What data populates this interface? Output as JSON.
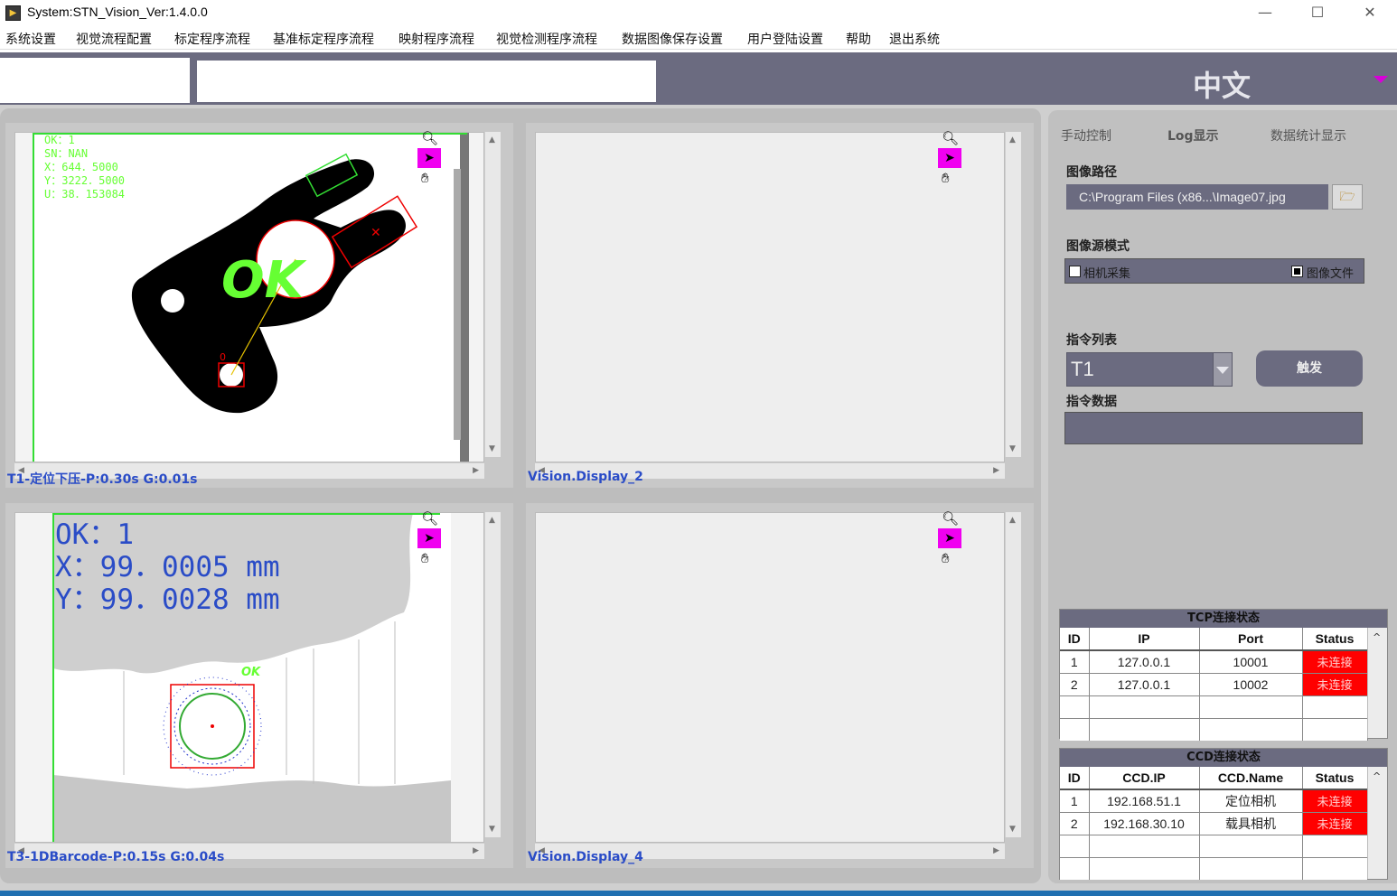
{
  "window": {
    "title": "System:STN_Vision_Ver:1.4.0.0",
    "icon": "app-icon",
    "controls": [
      "minimize-icon",
      "maximize-icon",
      "close-icon"
    ]
  },
  "menu": [
    "系统设置",
    "视觉流程配置",
    "标定程序流程",
    "基准标定程序流程",
    "映射程序流程",
    "视觉检测程序流程",
    "数据图像保存设置",
    "用户登陆设置",
    "帮助",
    "退出系统"
  ],
  "toolbar": {
    "language": "中文"
  },
  "displays": [
    {
      "caption": "T1-定位下压-P:0.30s G:0.01s",
      "overlay": [
        "OK：1",
        "SN：NAN",
        "X：644．5000",
        "Y：3222．5000",
        "U：38．153084"
      ],
      "result": "OK",
      "point_label": "0"
    },
    {
      "caption": "Vision.Display_2"
    },
    {
      "caption": "T3-1DBarcode-P:0.15s G:0.04s",
      "overlay": [
        "OK：1",
        "X：99．0005 mm",
        "Y：99．0028 mm"
      ],
      "result": "OK"
    },
    {
      "caption": "Vision.Display_4"
    }
  ],
  "right_panel": {
    "tabs": [
      "手动控制",
      "Log显示",
      "数据统计显示"
    ],
    "image_path_label": "图像路径",
    "image_path": "C:\\Program Files (x86...\\Image07.jpg",
    "source_mode_label": "图像源模式",
    "source_camera": "相机采集",
    "source_file": "图像文件",
    "source_selected": "图像文件",
    "command_list_label": "指令列表",
    "command_value": "T1",
    "trigger_label": "触发",
    "command_data_label": "指令数据",
    "command_data": ""
  },
  "tcp_table": {
    "title": "TCP连接状态",
    "headers": [
      "ID",
      "IP",
      "Port",
      "Status"
    ],
    "rows": [
      [
        "1",
        "127.0.0.1",
        "10001",
        "未连接"
      ],
      [
        "2",
        "127.0.0.1",
        "10002",
        "未连接"
      ]
    ],
    "status_color": "#ff0000"
  },
  "ccd_table": {
    "title": "CCD连接状态",
    "headers": [
      "ID",
      "CCD.IP",
      "CCD.Name",
      "Status"
    ],
    "rows": [
      [
        "1",
        "192.168.51.1",
        "定位相机",
        "未连接"
      ],
      [
        "2",
        "192.168.30.10",
        "载具相机",
        "未连接"
      ]
    ],
    "status_color": "#ff0000"
  },
  "colors": {
    "toolbar": "#6b6b80",
    "tool_highlight": "#f000f0",
    "caption": "#2a4cc7",
    "overlay_green": "#66ff33",
    "overlay_blue": "#2a4cc7"
  }
}
